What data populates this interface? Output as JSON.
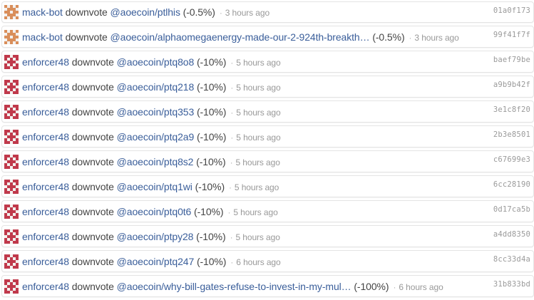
{
  "colors": {
    "link": "#3a5e9a",
    "muted": "#999999",
    "border": "#e4e4e4",
    "mackbot_avatar": "#d98e5a",
    "enforcer_avatar": "#c0394b"
  },
  "activity": [
    {
      "user": "mack-bot",
      "avatar_icon": "mack-bot-identicon",
      "action": "downvote",
      "post": "@aoecoin/ptlhis",
      "percent": "(-0.5%)",
      "sep": "·",
      "time": "3 hours ago",
      "hash": "01a0f173"
    },
    {
      "user": "mack-bot",
      "avatar_icon": "mack-bot-identicon",
      "action": "downvote",
      "post": "@aoecoin/alphaomegaenergy-made-our-2-924th-breakth…",
      "percent": "(-0.5%)",
      "sep": "·",
      "time": "3 hours ago",
      "hash": "99f41f7f"
    },
    {
      "user": "enforcer48",
      "avatar_icon": "enforcer48-identicon",
      "action": "downvote",
      "post": "@aoecoin/ptq8o8",
      "percent": "(-10%)",
      "sep": "·",
      "time": "5 hours ago",
      "hash": "baef79be"
    },
    {
      "user": "enforcer48",
      "avatar_icon": "enforcer48-identicon",
      "action": "downvote",
      "post": "@aoecoin/ptq218",
      "percent": "(-10%)",
      "sep": "·",
      "time": "5 hours ago",
      "hash": "a9b9b42f"
    },
    {
      "user": "enforcer48",
      "avatar_icon": "enforcer48-identicon",
      "action": "downvote",
      "post": "@aoecoin/ptq353",
      "percent": "(-10%)",
      "sep": "·",
      "time": "5 hours ago",
      "hash": "3e1c8f20"
    },
    {
      "user": "enforcer48",
      "avatar_icon": "enforcer48-identicon",
      "action": "downvote",
      "post": "@aoecoin/ptq2a9",
      "percent": "(-10%)",
      "sep": "·",
      "time": "5 hours ago",
      "hash": "2b3e8501"
    },
    {
      "user": "enforcer48",
      "avatar_icon": "enforcer48-identicon",
      "action": "downvote",
      "post": "@aoecoin/ptq8s2",
      "percent": "(-10%)",
      "sep": "·",
      "time": "5 hours ago",
      "hash": "c67699e3"
    },
    {
      "user": "enforcer48",
      "avatar_icon": "enforcer48-identicon",
      "action": "downvote",
      "post": "@aoecoin/ptq1wi",
      "percent": "(-10%)",
      "sep": "·",
      "time": "5 hours ago",
      "hash": "6cc28190"
    },
    {
      "user": "enforcer48",
      "avatar_icon": "enforcer48-identicon",
      "action": "downvote",
      "post": "@aoecoin/ptq0t6",
      "percent": "(-10%)",
      "sep": "·",
      "time": "5 hours ago",
      "hash": "0d17ca5b"
    },
    {
      "user": "enforcer48",
      "avatar_icon": "enforcer48-identicon",
      "action": "downvote",
      "post": "@aoecoin/ptpy28",
      "percent": "(-10%)",
      "sep": "·",
      "time": "5 hours ago",
      "hash": "a4dd8350"
    },
    {
      "user": "enforcer48",
      "avatar_icon": "enforcer48-identicon",
      "action": "downvote",
      "post": "@aoecoin/ptq247",
      "percent": "(-10%)",
      "sep": "·",
      "time": "6 hours ago",
      "hash": "8cc33d4a"
    },
    {
      "user": "enforcer48",
      "avatar_icon": "enforcer48-identicon",
      "action": "downvote",
      "post": "@aoecoin/why-bill-gates-refuse-to-invest-in-my-mul…",
      "percent": "(-100%)",
      "sep": "·",
      "time": "6 hours ago",
      "hash": "31b833bd"
    }
  ]
}
